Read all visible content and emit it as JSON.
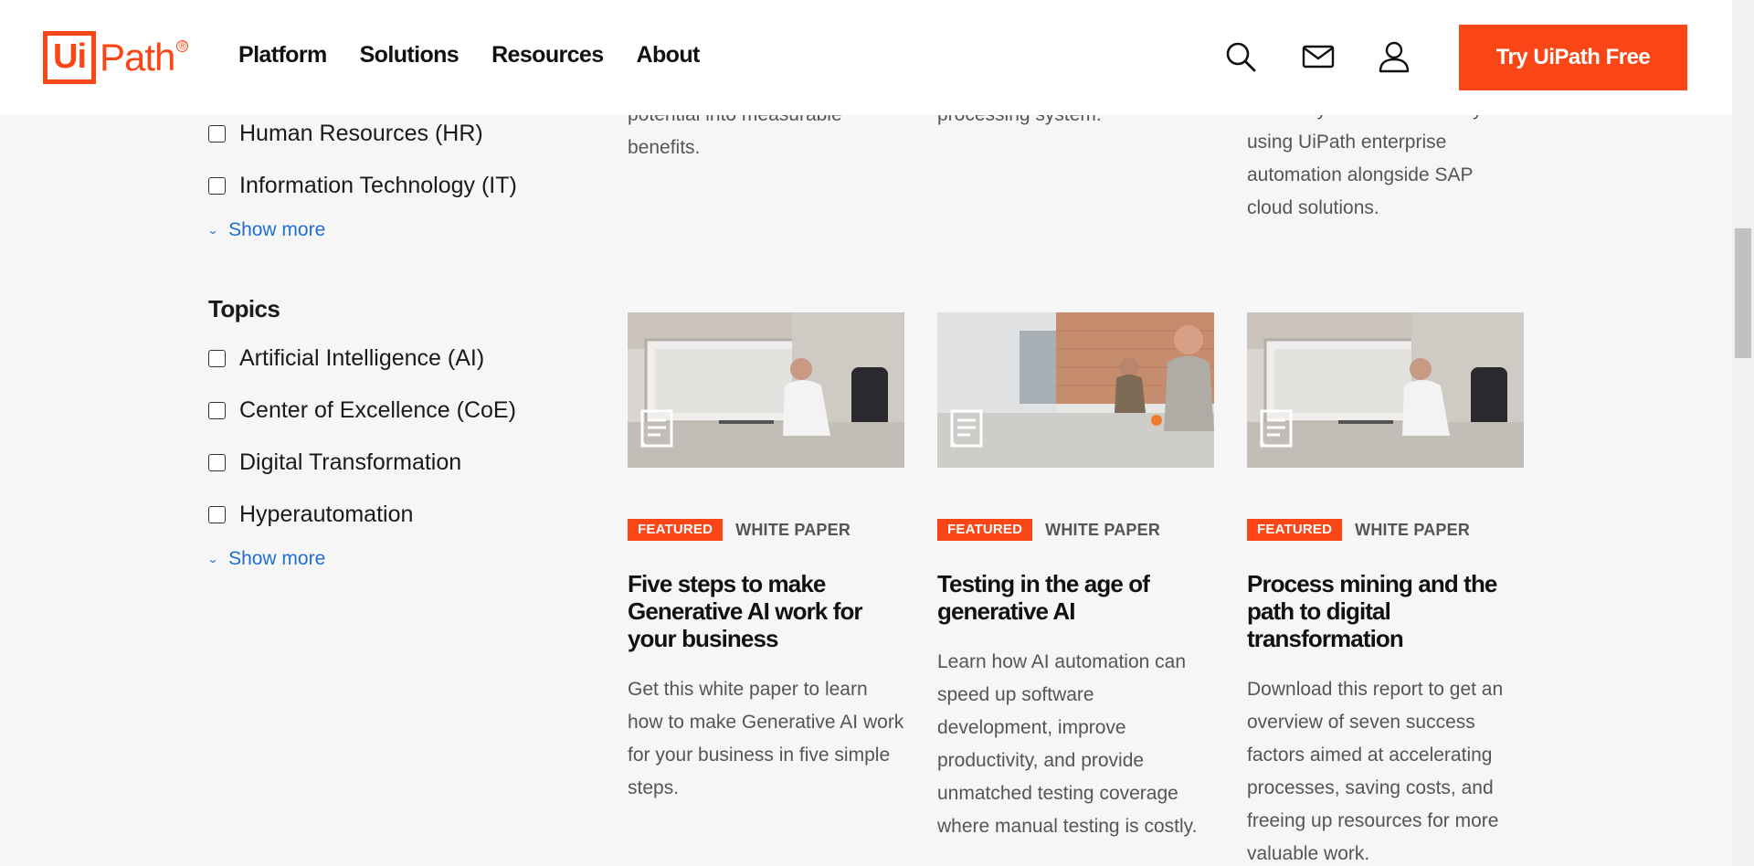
{
  "header": {
    "logo_text": "UiPath",
    "nav": [
      "Platform",
      "Solutions",
      "Resources",
      "About"
    ],
    "cta_label": "Try UiPath Free",
    "icons": [
      "search-icon",
      "mail-icon",
      "user-icon"
    ],
    "accent_color": "#fa4616"
  },
  "filters": {
    "departments": [
      "Human Resources (HR)",
      "Information Technology (IT)"
    ],
    "show_more_1": "Show more",
    "topics_title": "Topics",
    "topics": [
      "Artificial Intelligence (AI)",
      "Center of Excellence (CoE)",
      "Digital Transformation",
      "Hyperautomation"
    ],
    "show_more_2": "Show more"
  },
  "top_cards": [
    {
      "lines": [
        "potential into measurable",
        "benefits."
      ]
    },
    {
      "lines": [
        "processing system."
      ]
    },
    {
      "lines": [
        "efficiency and innovation by",
        "using UiPath enterprise",
        "automation alongside SAP",
        "cloud solutions."
      ]
    }
  ],
  "cards": [
    {
      "badge": "FEATURED",
      "type": "WHITE PAPER",
      "title": "Five steps to make Generative AI work for your business",
      "description": "Get this white paper to learn how to make Generative AI work for your business in five simple steps."
    },
    {
      "badge": "FEATURED",
      "type": "WHITE PAPER",
      "title": "Testing in the age of generative AI",
      "description": "Learn how AI automation can speed up software development, improve productivity, and provide unmatched testing coverage where manual testing is costly."
    },
    {
      "badge": "FEATURED",
      "type": "WHITE PAPER",
      "title": "Process mining and the path to digital transformation",
      "description": "Download this report to get an overview of seven success factors aimed at accelerating processes, saving costs, and freeing up resources for more valuable work."
    }
  ]
}
